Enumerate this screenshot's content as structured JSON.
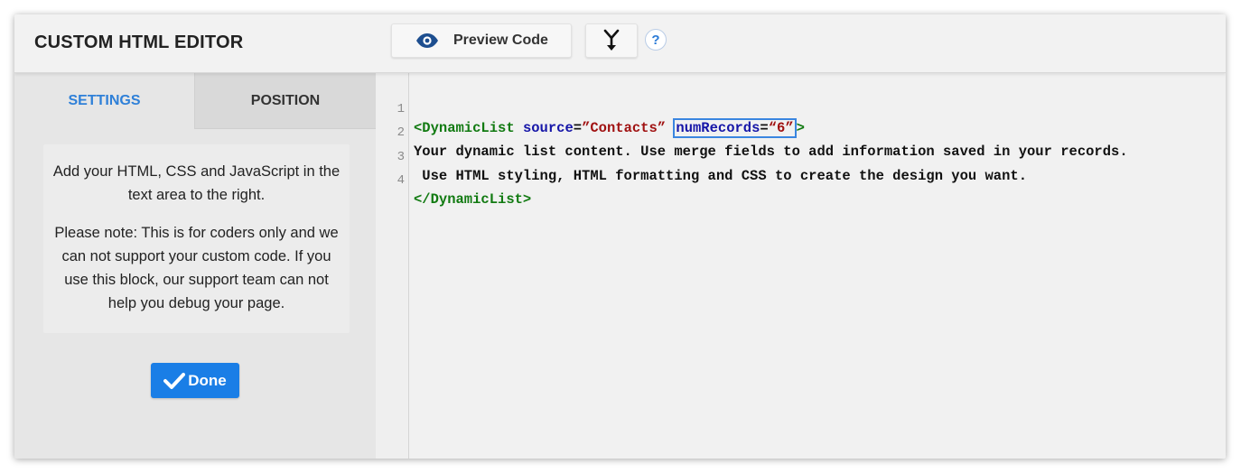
{
  "header": {
    "title": "CUSTOM HTML EDITOR",
    "preview_label": "Preview Code",
    "help_label": "?"
  },
  "tabs": [
    {
      "label": "SETTINGS",
      "active": true
    },
    {
      "label": "POSITION",
      "active": false
    }
  ],
  "notice": {
    "paragraph1": "Add your HTML, CSS and JavaScript in the text area to the right.",
    "paragraph2": "Please note: This is for coders only and we can not support your custom code. If you use this block, our support team can not help you debug your page."
  },
  "done_label": "Done",
  "editor": {
    "line_numbers": [
      "1",
      "2",
      "3",
      "4"
    ],
    "line1": {
      "tag_open": "<DynamicList",
      "attr1_name": "source",
      "eq1": "=",
      "attr1_value": "”Contacts”",
      "attr2_name": "numRecords",
      "eq2": "=",
      "attr2_value": "“6”",
      "close": ">"
    },
    "line2": "Your dynamic list content. Use merge fields to add information saved in your records.",
    "line3": " Use HTML styling, HTML formatting and CSS to create the design you want.",
    "line4": "</DynamicList>"
  },
  "colors": {
    "accent": "#1a7ee6",
    "tab_active_text": "#2f80d8",
    "code_tag": "#117a11",
    "code_attr": "#1616a8",
    "code_string": "#a01212",
    "highlight_border": "#3a86e0"
  },
  "icons": {
    "preview": "eye-icon",
    "merge": "merge-arrow-icon",
    "help": "help-icon",
    "done": "checkmark-icon"
  }
}
